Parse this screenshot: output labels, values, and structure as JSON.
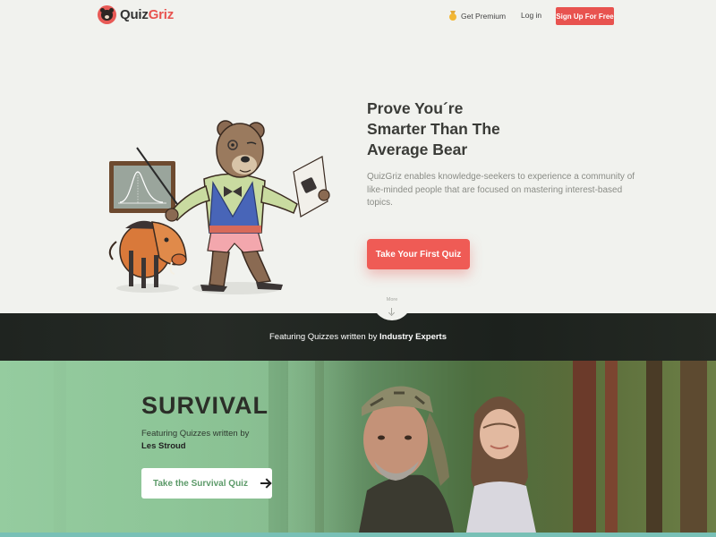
{
  "nav": {
    "logo_text_a": "Quiz",
    "logo_text_b": "Griz",
    "premium_label": "Get Premium",
    "login_label": "Log in",
    "signup_label": "Sign Up For Free",
    "premium_icon": "medal-icon",
    "brand_color": "#e8534f"
  },
  "hero": {
    "title_lines": [
      "Prove You´re",
      "Smarter Than The",
      "Average Bear"
    ],
    "description": "QuizGriz enables knowledge-seekers to experience a community of like-minded people that are focused on mastering interest-based topics.",
    "cta_label": "Take Your First Quiz",
    "more_label": "More"
  },
  "featured": {
    "text_prefix": "Featuring Quizzes written by ",
    "text_bold": "Industry Experts"
  },
  "survival": {
    "title": "SURVIVAL",
    "subtitle": "Featuring Quizzes written by",
    "author": "Les Stroud",
    "button_label": "Take the Survival Quiz",
    "accent_color": "#5c9a69"
  }
}
